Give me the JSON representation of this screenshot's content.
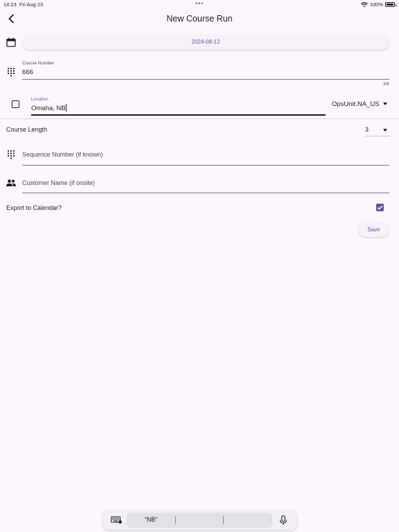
{
  "status_bar": {
    "time": "14:23",
    "date": "Fri Aug 23",
    "battery": "100%"
  },
  "app_bar": {
    "title": "New Course Run"
  },
  "form": {
    "date_value": "2024-08-12",
    "course_number": {
      "label": "Course Number",
      "value": "666",
      "counter": "3/6"
    },
    "location": {
      "label": "Location",
      "value": "Omaha, NB",
      "ops_unit": "OpsUnit.NA_US"
    },
    "course_length": {
      "label": "Course Length",
      "value": "3"
    },
    "sequence_number": {
      "placeholder": "Sequence Number (if known)"
    },
    "customer_name": {
      "placeholder": "Customer Name (if onsite)"
    },
    "export_calendar": {
      "label": "Export to Calendar?",
      "checked": true
    },
    "save_label": "Save"
  },
  "keyboard_bar": {
    "suggestion": "“NB”"
  },
  "colors": {
    "background": "#fdf7fd",
    "accent": "#6750a4",
    "text": "#1d1b20"
  }
}
